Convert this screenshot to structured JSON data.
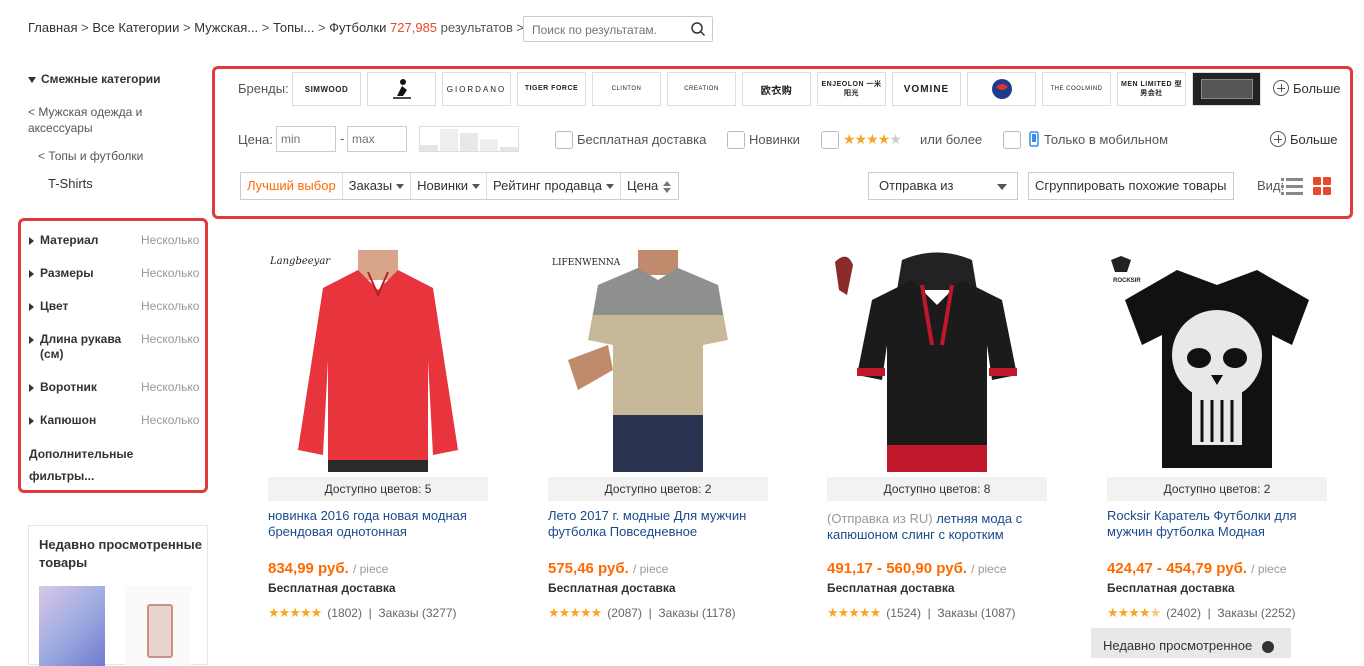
{
  "breadcrumb": {
    "home": "Главная",
    "all": "Все Категории",
    "men": "Мужская...",
    "tops": "Топы...",
    "current": "Футболки",
    "count": "727,985",
    "results": "результатов",
    "sep": ">"
  },
  "search": {
    "placeholder": "Поиск по результатам."
  },
  "sidebar": {
    "related_title": "Смежные категории",
    "cat1": "< Мужская одежда и аксессуары",
    "cat2": "< Топы и футболки",
    "cat3": "T-Shirts",
    "filters": [
      {
        "name": "Материал",
        "value": "Несколько"
      },
      {
        "name": "Размеры",
        "value": "Несколько"
      },
      {
        "name": "Цвет",
        "value": "Несколько"
      },
      {
        "name": "Длина рукава (см)",
        "value": "Несколько"
      },
      {
        "name": "Воротник",
        "value": "Несколько"
      },
      {
        "name": "Капюшон",
        "value": "Несколько"
      }
    ],
    "more_filters": "Дополнительные фильтры...",
    "recent_title": "Недавно просмотренные товары"
  },
  "panel": {
    "brands_label": "Бренды:",
    "brands": [
      "SIMWOOD",
      "",
      "GIORDANO",
      "TIGER FORCE",
      "CLINTON",
      "CREATION",
      "欧衣购",
      "ENJEOLON 一米阳光",
      "VOMINE",
      "",
      "THE COOLMIND",
      "MEN LIMITED 型男会社",
      ""
    ],
    "more": "Больше",
    "price_label": "Цена:",
    "min_placeholder": "min",
    "max_placeholder": "max",
    "dash": "-",
    "free_shipping": "Бесплатная доставка",
    "new_items": "Новинки",
    "or_more": "или более",
    "mobile_only": "Только в мобильном",
    "sort": [
      "Лучший выбор",
      "Заказы",
      "Новинки",
      "Рейтинг продавца",
      "Цена"
    ],
    "ship_from": "Отправка из",
    "group": "Сгруппировать похожие товары",
    "view_label": "Вид:"
  },
  "products": [
    {
      "brand": "Langbeeyar",
      "colors": "Доступно цветов: 5",
      "ship": "",
      "title": "новинка 2016 года новая модная брендовая однотонная",
      "price": "834,99 руб.",
      "unit": "/ piece",
      "free": "Бесплатная доставка",
      "reviews": "(1802)",
      "orders": "Заказы (3277)",
      "shirt_color": "#e8343c"
    },
    {
      "brand": "LIFENWENNA",
      "colors": "Доступно цветов: 2",
      "ship": "",
      "title": "Лето 2017 г. модные Для мужчин футболка Повседневное",
      "price": "575,46 руб.",
      "unit": "/ piece",
      "free": "Бесплатная доставка",
      "reviews": "(2087)",
      "orders": "Заказы (1178)",
      "shirt_color": "#c8b89a"
    },
    {
      "brand": "",
      "colors": "Доступно цветов: 8",
      "ship": "(Отправка из RU)",
      "title": "летняя мода с капюшоном слинг с коротким",
      "price": "491,17 - 560,90 руб.",
      "unit": "/ piece",
      "free": "Бесплатная доставка",
      "reviews": "(1524)",
      "orders": "Заказы (1087)",
      "shirt_color": "#1b1b1b"
    },
    {
      "brand": "ROCKSIR",
      "colors": "Доступно цветов: 2",
      "ship": "",
      "title": "Rocksir Каратель Футболки для мужчин футболка Модная",
      "price": "424,47 - 454,79 руб.",
      "unit": "/ piece",
      "free": "Бесплатная доставка",
      "reviews": "(2402)",
      "orders": "Заказы (2252)",
      "shirt_color": "#111111"
    }
  ],
  "recent_bar": "Недавно просмотренное",
  "colors": {
    "accent": "#ff6a00",
    "highlight_border": "#e03a3a",
    "link": "#1a4b8c",
    "star": "#f5a623"
  }
}
